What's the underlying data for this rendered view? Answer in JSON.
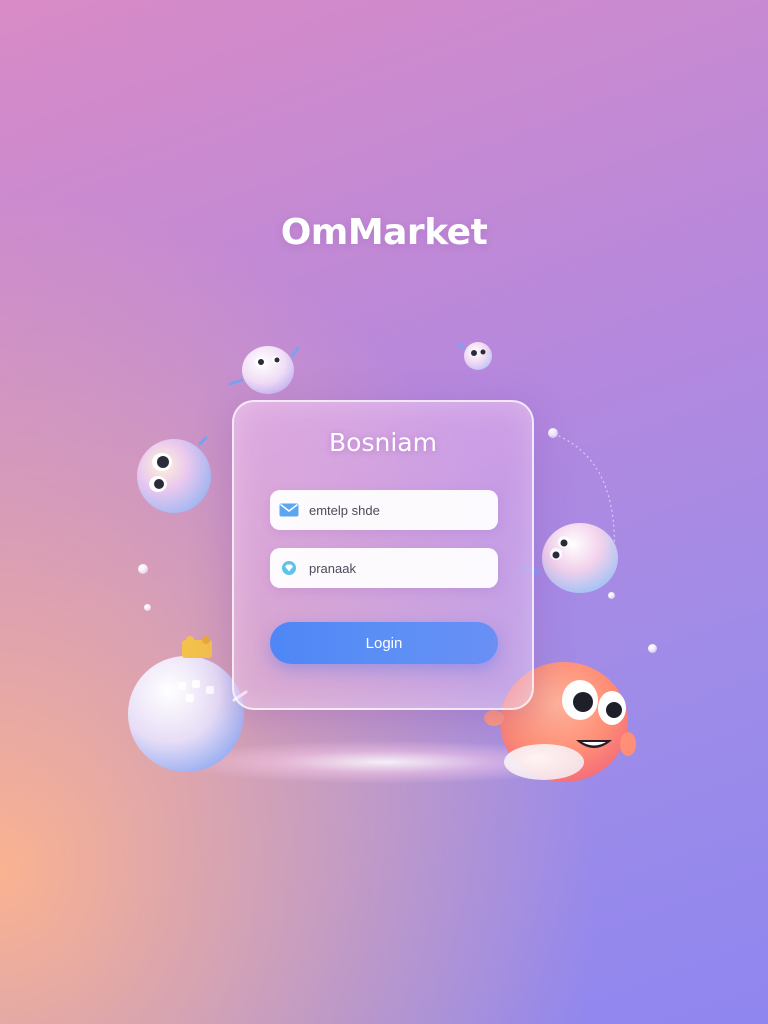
{
  "brand": {
    "name": "OmMarket"
  },
  "login_card": {
    "title": "Bosniam",
    "email_field": {
      "value": "emtelp shde",
      "icon": "mail-icon"
    },
    "password_field": {
      "value": "pranaak",
      "icon": "diamond-icon"
    },
    "login_button": {
      "label": "Login"
    }
  },
  "colors": {
    "button": "#4f86f7",
    "background_top": "#b488de",
    "background_bottom_left": "#ffb48c",
    "background_right": "#8f86ef"
  }
}
